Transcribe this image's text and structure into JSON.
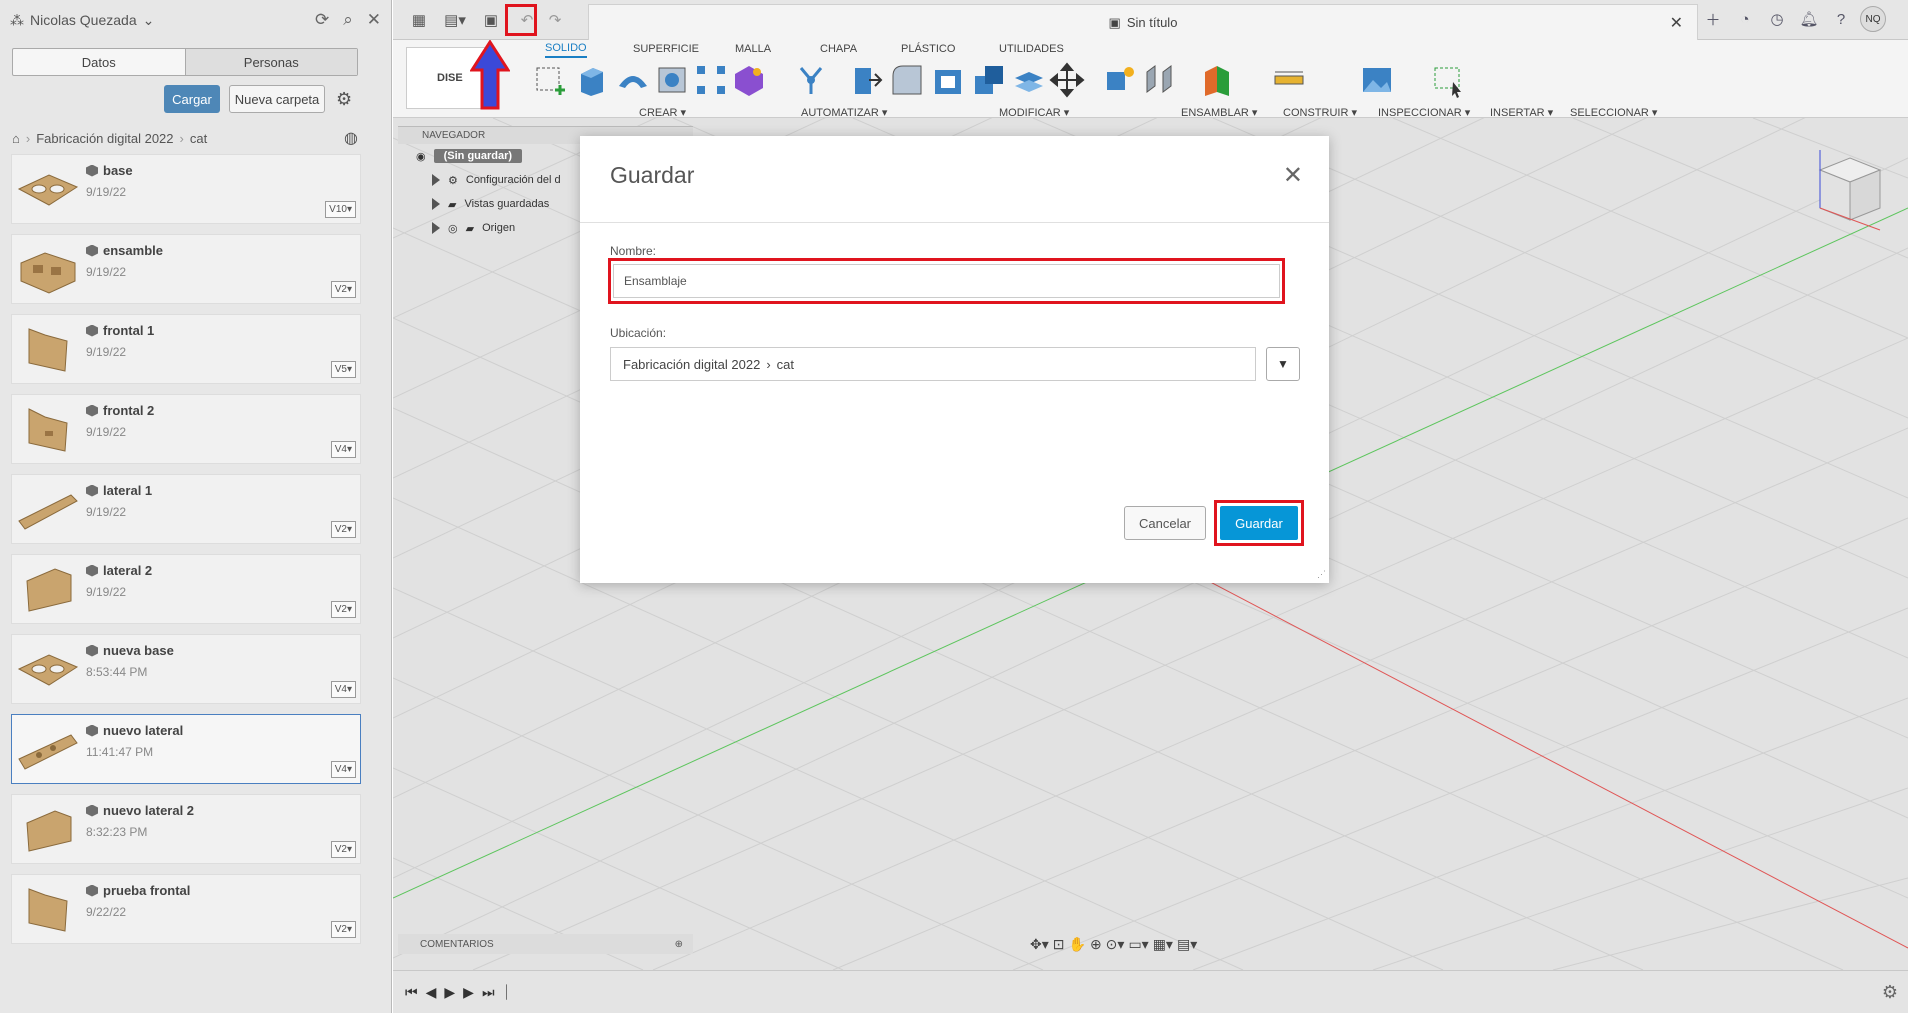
{
  "data_panel": {
    "user_name": "Nicolas Quezada",
    "tabs": [
      "Datos",
      "Personas"
    ],
    "upload_label": "Cargar",
    "new_folder_label": "Nueva carpeta",
    "breadcrumb": [
      "Fabricación digital 2022",
      "cat"
    ],
    "files": [
      {
        "name": "base",
        "date": "9/19/22",
        "version": "V10"
      },
      {
        "name": "ensamble",
        "date": "9/19/22",
        "version": "V2"
      },
      {
        "name": "frontal 1",
        "date": "9/19/22",
        "version": "V5"
      },
      {
        "name": "frontal 2",
        "date": "9/19/22",
        "version": "V4"
      },
      {
        "name": "lateral 1",
        "date": "9/19/22",
        "version": "V2"
      },
      {
        "name": "lateral 2",
        "date": "9/19/22",
        "version": "V2"
      },
      {
        "name": "nueva base",
        "date": "8:53:44 PM",
        "version": "V4"
      },
      {
        "name": "nuevo lateral",
        "date": "11:41:47 PM",
        "version": "V4"
      },
      {
        "name": "nuevo lateral 2",
        "date": "8:32:23 PM",
        "version": "V2"
      },
      {
        "name": "prueba frontal",
        "date": "9/22/22",
        "version": "V2"
      }
    ],
    "selected_file": "nuevo lateral"
  },
  "toolbar": {
    "document_title": "Sin título",
    "avatar_initials": "NQ"
  },
  "ribbon": {
    "workspace": "DISE",
    "tabs": [
      "SOLIDO",
      "SUPERFICIE",
      "MALLA",
      "CHAPA",
      "PLÁSTICO",
      "UTILIDADES"
    ],
    "active_tab": "SOLIDO",
    "groups": [
      "CREAR ▾",
      "AUTOMATIZAR ▾",
      "MODIFICAR ▾",
      "ENSAMBLAR ▾",
      "CONSTRUIR ▾",
      "INSPECCIONAR ▾",
      "INSERTAR ▾",
      "SELECCIONAR ▾"
    ]
  },
  "browser": {
    "header": "NAVEGADOR",
    "root": "(Sin guardar)",
    "items": [
      "Configuración del d",
      "Vistas guardadas",
      "Origen"
    ],
    "comments": "COMENTARIOS"
  },
  "dialog": {
    "title": "Guardar",
    "name_label": "Nombre:",
    "name_value": "Ensamblaje",
    "location_label": "Ubicación:",
    "location_path": [
      "Fabricación  digital 2022",
      "cat"
    ],
    "cancel_label": "Cancelar",
    "save_label": "Guardar"
  },
  "colors": {
    "highlight": "#e0141e",
    "primary_button": "#0696d7",
    "upload_button": "#4e87b7",
    "arrow_fill": "#3b49d8"
  },
  "icons": [
    "grid-menu-icon",
    "file-icon",
    "save-icon",
    "undo-icon",
    "redo-icon",
    "refresh-icon",
    "search-icon",
    "close-icon",
    "gear-icon",
    "home-icon",
    "globe-icon",
    "plus-icon",
    "help-icon",
    "bell-icon",
    "clock-icon"
  ]
}
